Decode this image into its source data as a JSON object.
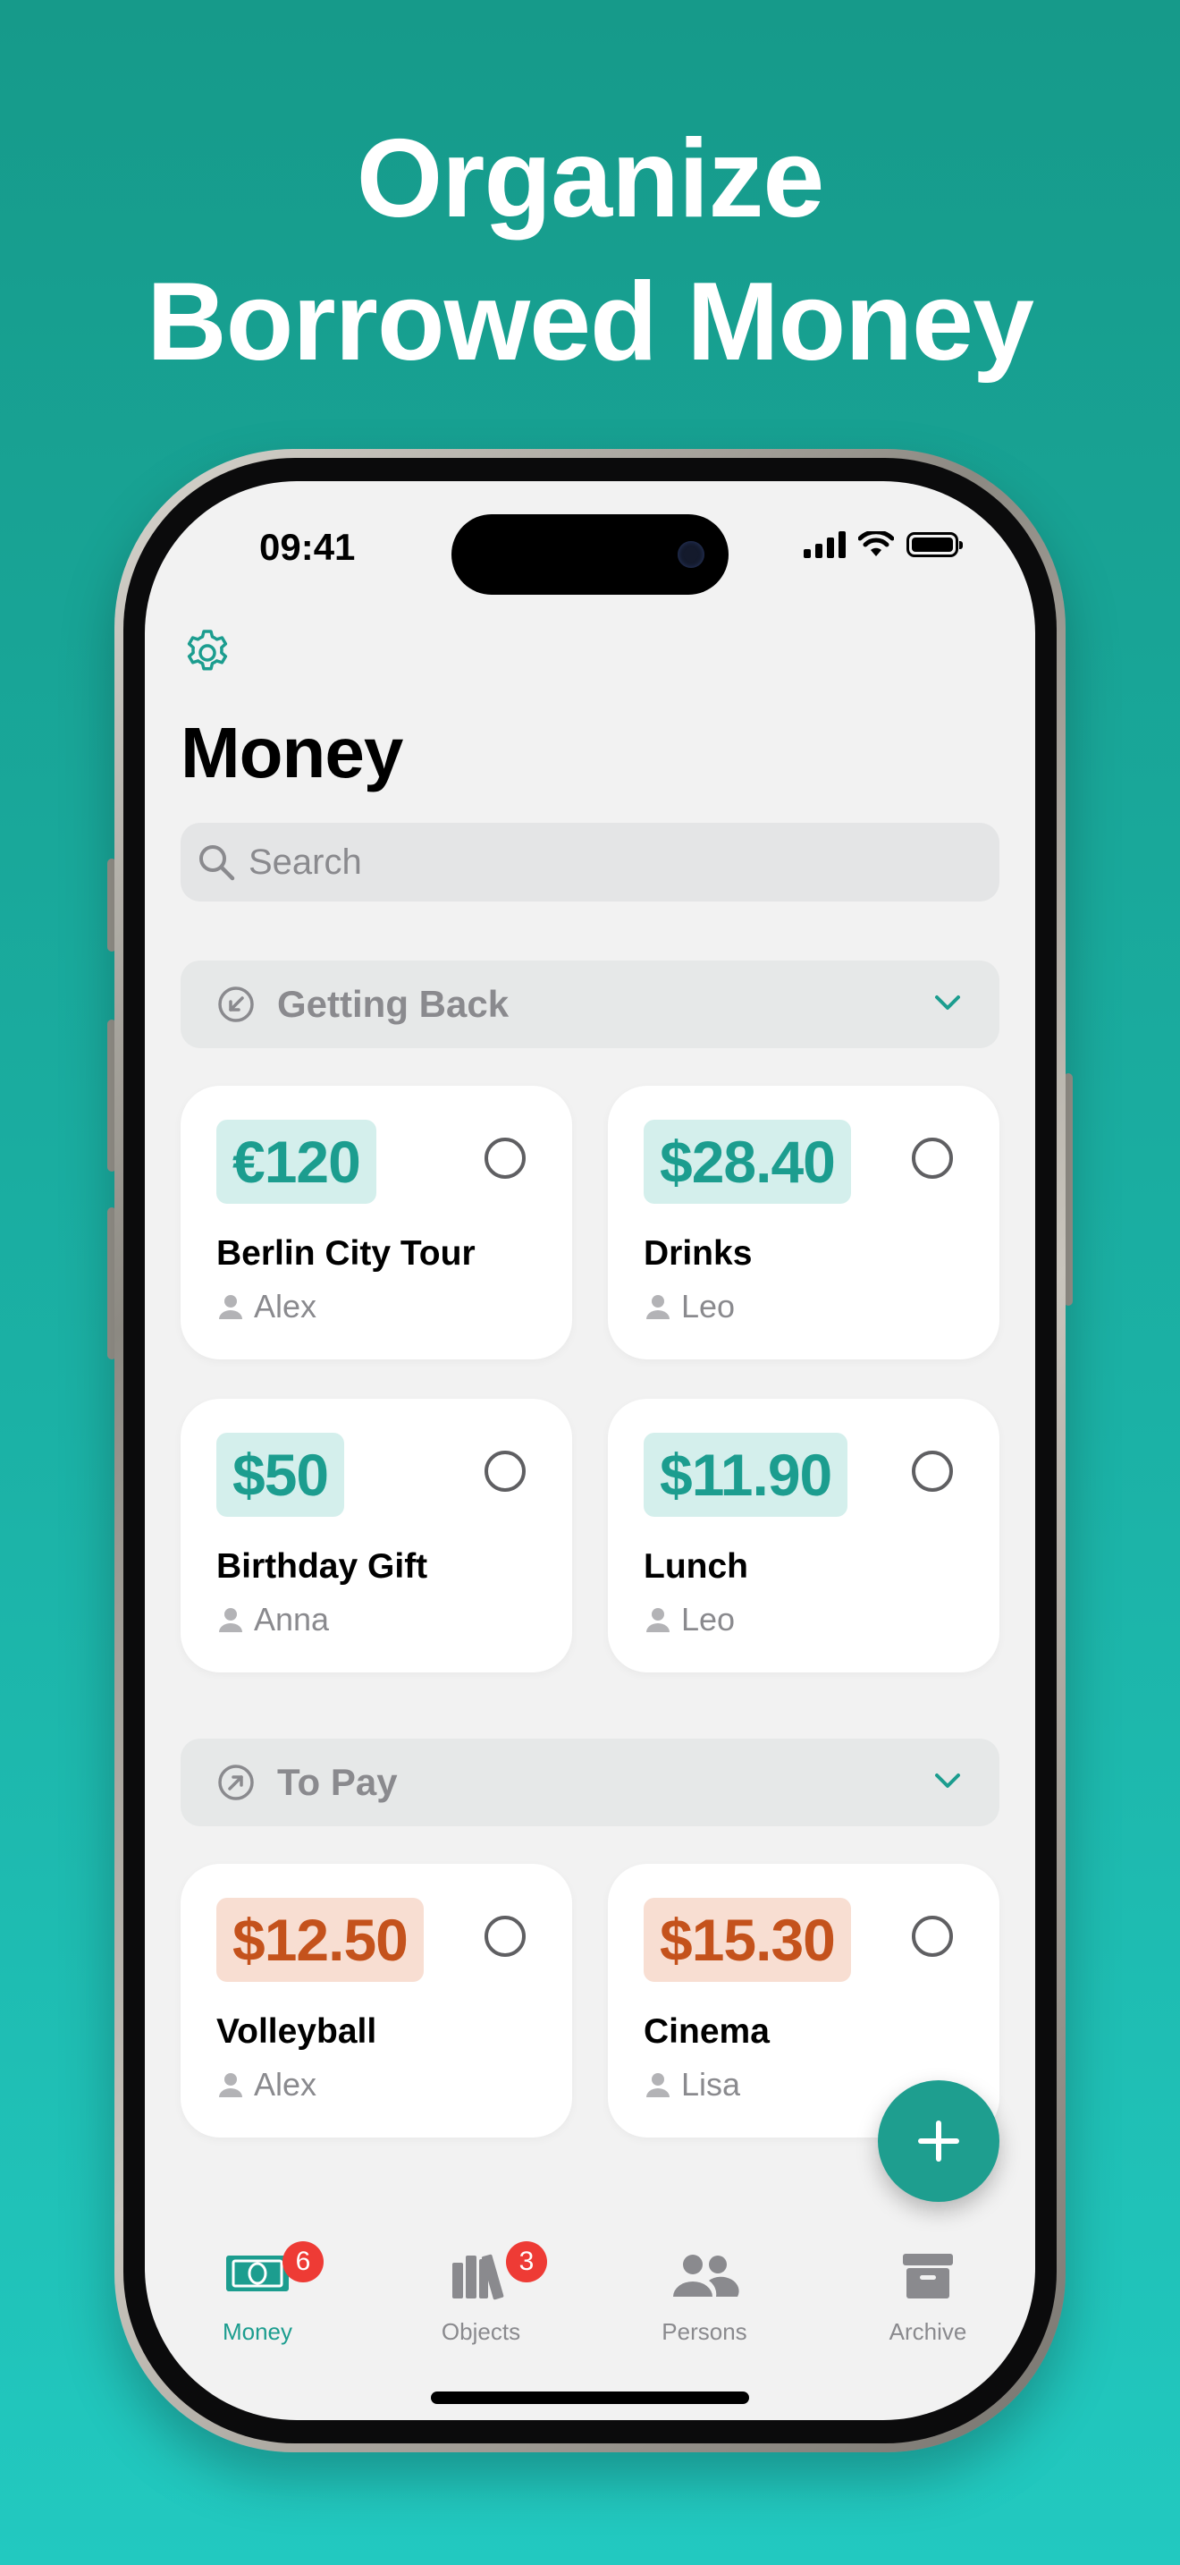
{
  "headline": {
    "line1": "Organize",
    "line2": "Borrowed Money"
  },
  "status_bar": {
    "time": "09:41"
  },
  "page": {
    "title": "Money"
  },
  "search": {
    "placeholder": "Search"
  },
  "sections": {
    "getting_back": {
      "title": "Getting Back",
      "cards": [
        {
          "amount": "€120",
          "title": "Berlin City Tour",
          "person": "Alex"
        },
        {
          "amount": "$28.40",
          "title": "Drinks",
          "person": "Leo"
        },
        {
          "amount": "$50",
          "title": "Birthday Gift",
          "person": "Anna"
        },
        {
          "amount": "$11.90",
          "title": "Lunch",
          "person": "Leo"
        }
      ]
    },
    "to_pay": {
      "title": "To Pay",
      "cards": [
        {
          "amount": "$12.50",
          "title": "Volleyball",
          "person": "Alex"
        },
        {
          "amount": "$15.30",
          "title": "Cinema",
          "person": "Lisa"
        }
      ]
    }
  },
  "tabbar": {
    "tabs": [
      {
        "label": "Money",
        "badge": "6",
        "icon": "banknote-icon"
      },
      {
        "label": "Objects",
        "badge": "3",
        "icon": "books-icon"
      },
      {
        "label": "Persons",
        "icon": "persons-icon"
      },
      {
        "label": "Archive",
        "icon": "archive-icon"
      }
    ]
  },
  "colors": {
    "accent": "#1c9d8f",
    "back_amount_bg": "#d4efec",
    "pay_amount_text": "#c4521c",
    "pay_amount_bg": "#f8ded2",
    "badge": "#ee3b35"
  }
}
